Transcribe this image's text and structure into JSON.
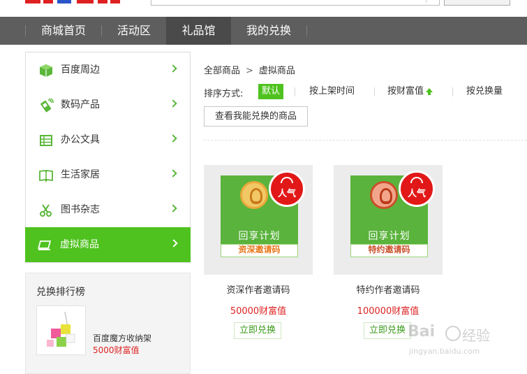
{
  "nav": {
    "items": [
      {
        "label": "商城首页"
      },
      {
        "label": "活动区"
      },
      {
        "label": "礼品馆",
        "active": true
      },
      {
        "label": "我的兑换"
      }
    ]
  },
  "sidebar": {
    "items": [
      {
        "label": "百度周边",
        "icon": "cube-icon"
      },
      {
        "label": "数码产品",
        "icon": "phone-icon"
      },
      {
        "label": "办公文具",
        "icon": "table-icon"
      },
      {
        "label": "生活家居",
        "icon": "book-icon"
      },
      {
        "label": "图书杂志",
        "icon": "scissors-icon"
      },
      {
        "label": "虚拟商品",
        "icon": "laptop-icon",
        "active": true
      }
    ]
  },
  "ranking": {
    "title": "兑换排行榜",
    "item": {
      "name": "百度魔方收纳架",
      "price": "5000财富值"
    }
  },
  "breadcrumb": {
    "root": "全部商品",
    "separator": ">",
    "current": "虚拟商品"
  },
  "sort": {
    "label": "排序方式:",
    "options": [
      {
        "label": "默认",
        "active": true
      },
      {
        "label": "按上架时间"
      },
      {
        "label": "按财富值",
        "arrow": "up"
      },
      {
        "label": "按兑换量"
      }
    ]
  },
  "view_button": "查看我能兑换的商品",
  "products": [
    {
      "name": "资深作者邀请码",
      "price": "50000财富值",
      "button": "立即兑换",
      "badge": "人气",
      "image": {
        "plan": "回享计划",
        "code": "资深邀请码"
      }
    },
    {
      "name": "特约作者邀请码",
      "price": "100000财富值",
      "button": "立即兑换",
      "badge": "人气",
      "image": {
        "plan": "回享计划",
        "code": "特约邀请码"
      }
    }
  ],
  "watermark": {
    "brand": "Bai",
    "cn": "经验",
    "url": "jingyan.baidu.com"
  },
  "colors": {
    "accent": "#4fc21f",
    "nav_bg": "#5e5e5e",
    "price": "#dd2222",
    "badge": "#e21818"
  }
}
